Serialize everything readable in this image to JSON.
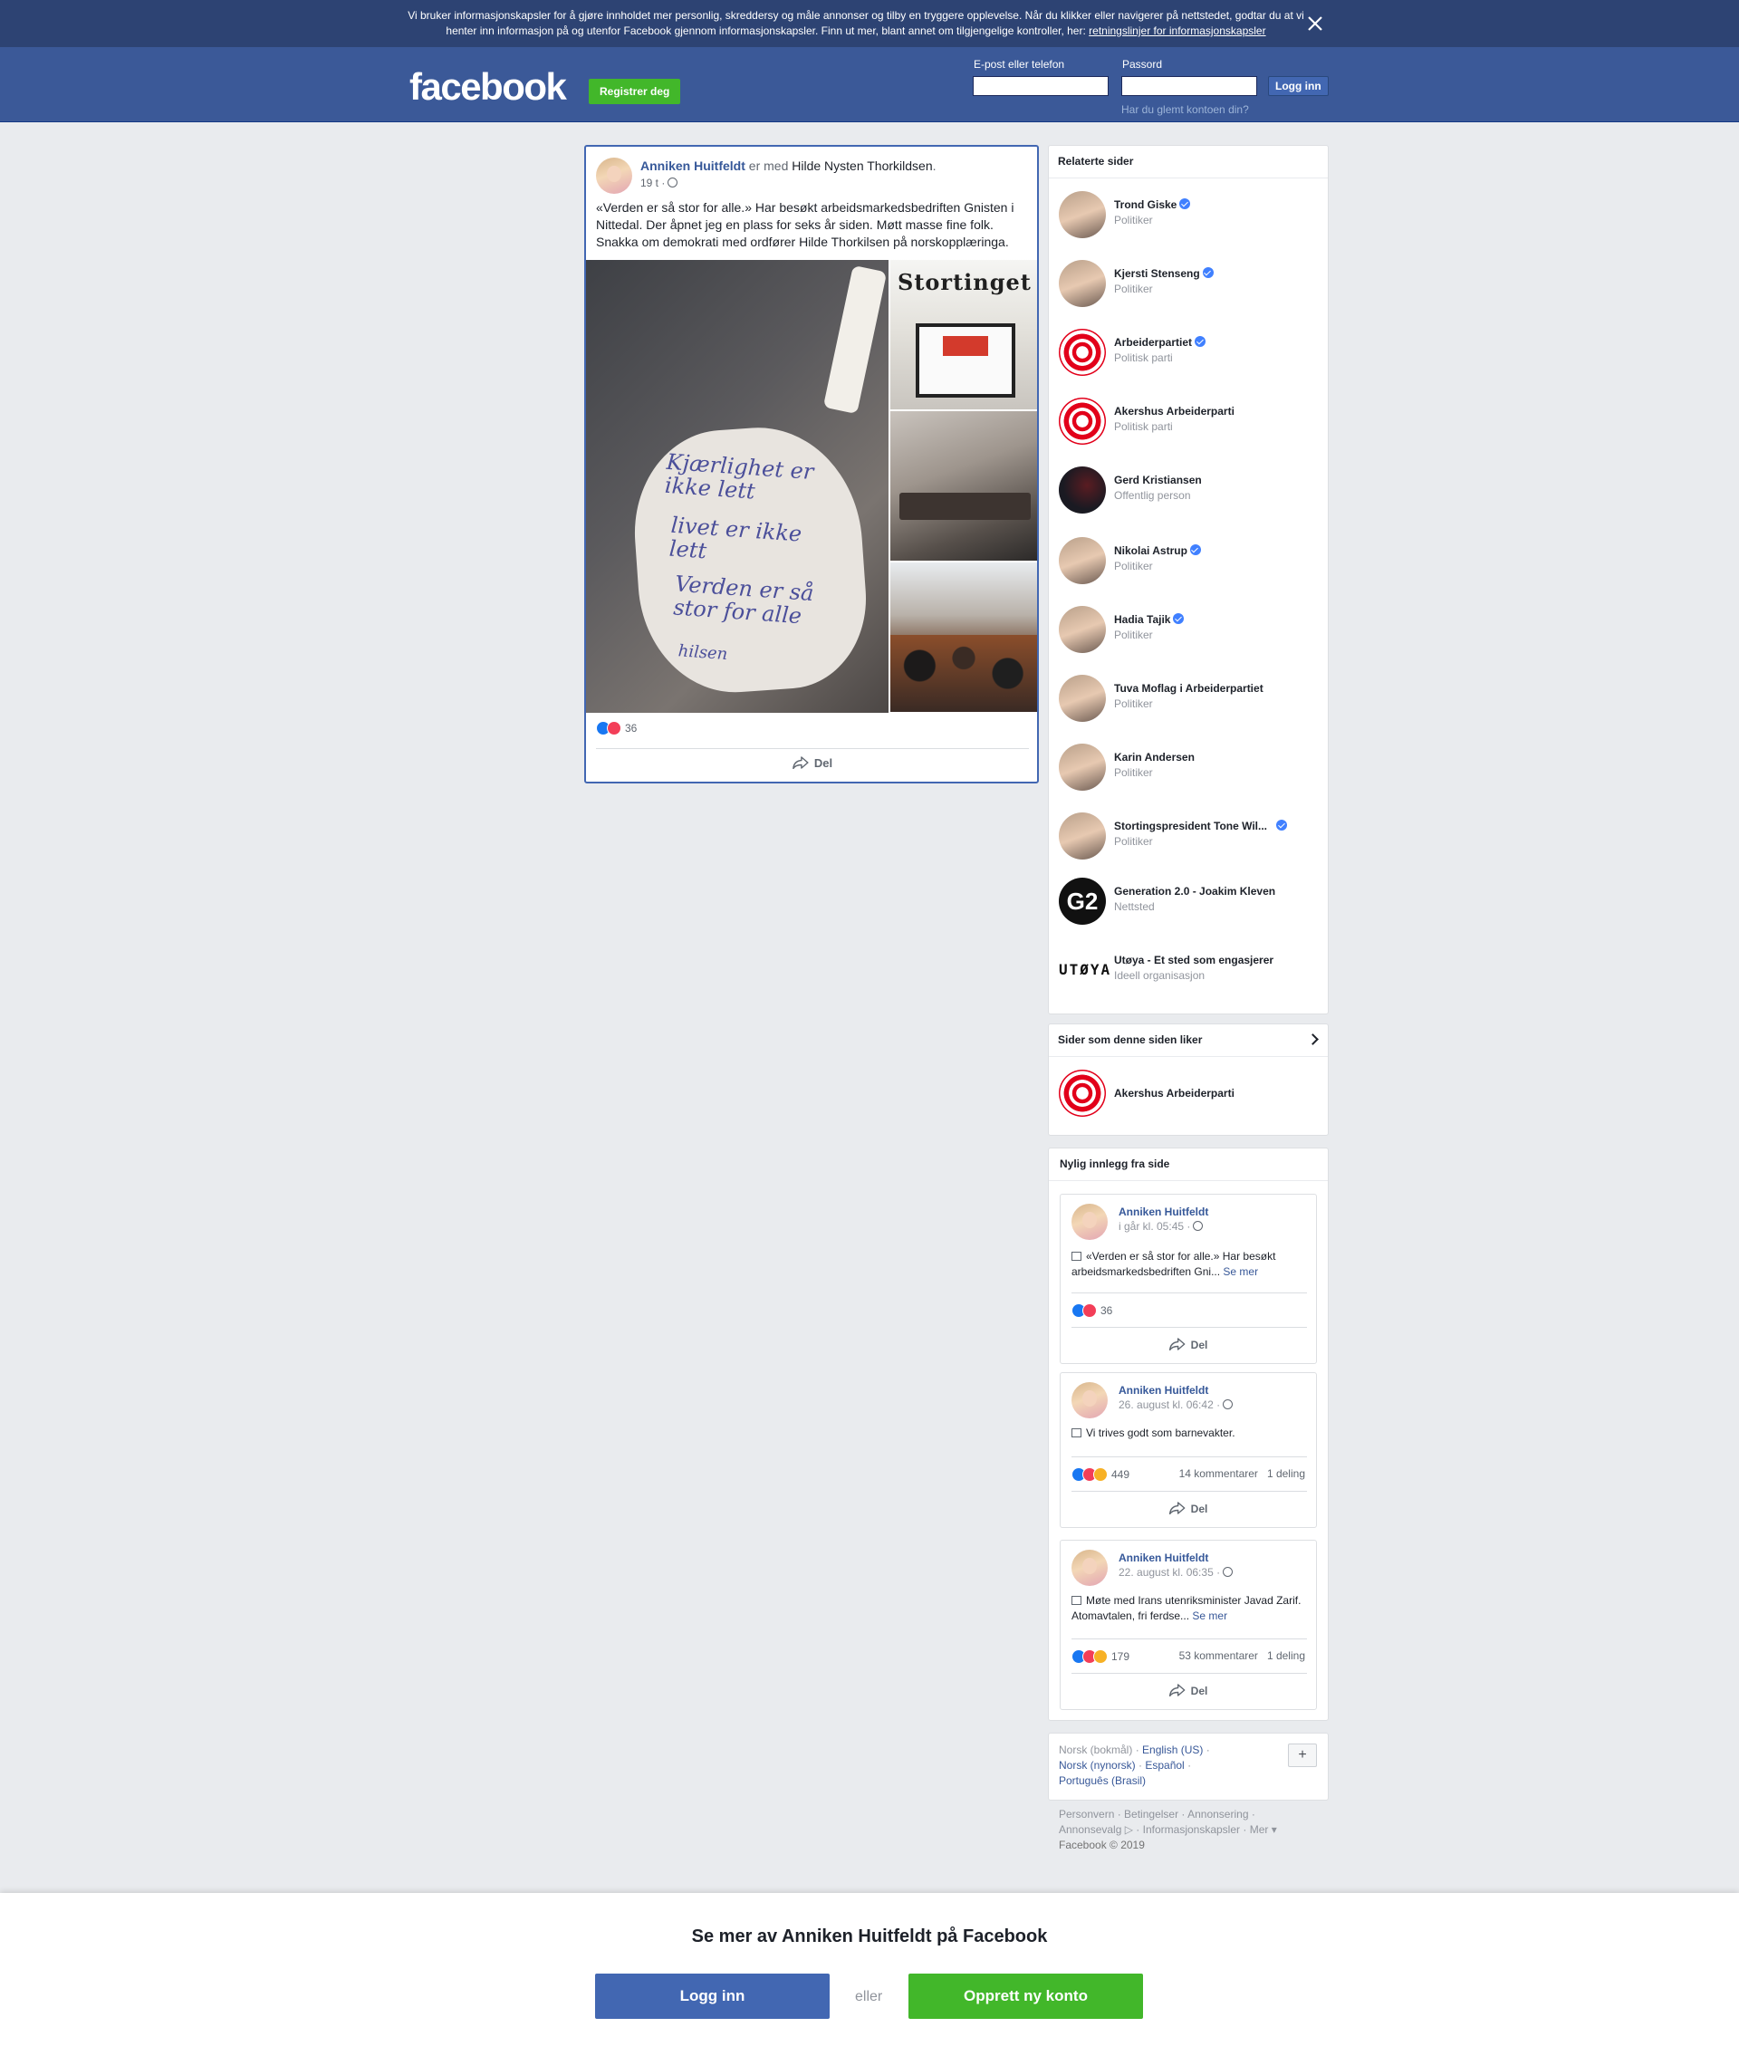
{
  "cookie_banner": {
    "text": "Vi bruker informasjonskapsler for å gjøre innholdet mer personlig, skreddersy og måle annonser og tilby en tryggere opplevelse. Når du klikker eller navigerer på nettstedet, godtar du at vi henter inn informasjon på og utenfor Facebook gjennom informasjonskapsler. Finn ut mer, blant annet om tilgjengelige kontroller, her: ",
    "link_text": "retningslinjer for informasjonskapsler"
  },
  "header": {
    "logo": "facebook",
    "register_label": "Registrer deg",
    "email_label": "E-post eller telefon",
    "email_value": "",
    "password_label": "Passord",
    "password_value": "",
    "login_label": "Logg inn",
    "forgot_label": "Har du glemt kontoen din?"
  },
  "post": {
    "author": "Anniken Huitfeldt",
    "with_text": " er med ",
    "with_person": "Hilde Nysten Thorkildsen",
    "with_suffix": ".",
    "time": "19 t ·",
    "text": "«Verden er så stor for alle.» Har besøkt arbeidsmarkedsbedriften Gnisten i Nittedal. Der åpnet jeg en plass for seks år siden. Møtt masse fine folk. Snakka om demokrati med ordfører Hilde Thorkilsen på norskopplæringa.",
    "note_lines": [
      "Kjærlighet er ikke lett",
      "livet er ikke lett",
      "Verden er så stor for alle",
      "hilsen"
    ],
    "photo_banner": "Stortinget",
    "reaction_count": "36",
    "share_label": "Del"
  },
  "related_pages": {
    "title": "Relaterte sider",
    "items": [
      {
        "name": "Trond Giske",
        "category": "Politiker",
        "verified": true
      },
      {
        "name": "Kjersti Stenseng",
        "category": "Politiker",
        "verified": true
      },
      {
        "name": "Arbeiderpartiet",
        "category": "Politisk parti",
        "verified": true
      },
      {
        "name": "Akershus Arbeiderparti",
        "category": "Politisk parti",
        "verified": false
      },
      {
        "name": "Gerd Kristiansen",
        "category": "Offentlig person",
        "verified": false
      },
      {
        "name": "Nikolai Astrup",
        "category": "Politiker",
        "verified": true
      },
      {
        "name": "Hadia Tajik",
        "category": "Politiker",
        "verified": true
      },
      {
        "name": "Tuva Moflag i Arbeiderpartiet",
        "category": "Politiker",
        "verified": false
      },
      {
        "name": "Karin Andersen",
        "category": "Politiker",
        "verified": false
      },
      {
        "name": "Stortingspresident Tone Wil...",
        "category": "Politiker",
        "verified": true
      },
      {
        "name": "Generation 2.0 - Joakim Kleven",
        "category": "Nettsted",
        "verified": false
      },
      {
        "name": "Utøya - Et sted som engasjerer",
        "category": "Ideell organisasjon",
        "verified": false
      }
    ],
    "g2_text": "G2",
    "utoya_text": "UTØYA"
  },
  "liked_pages": {
    "title": "Sider som denne siden liker",
    "items": [
      {
        "name": "Akershus Arbeiderparti"
      }
    ]
  },
  "recent_posts": {
    "title": "Nylig innlegg fra side",
    "items": [
      {
        "author": "Anniken Huitfeldt",
        "time": "i går kl. 05:45 ·",
        "text": "«Verden er så stor for alle.» Har besøkt arbeidsmarkedsbedriften Gni... ",
        "see_more": "Se mer",
        "reactions": "36",
        "comments": "",
        "shares": "",
        "share_label": "Del"
      },
      {
        "author": "Anniken Huitfeldt",
        "time": "26. august kl. 06:42 ·",
        "text": "Vi trives godt som barnevakter.",
        "see_more": "",
        "reactions": "449",
        "comments": "14 kommentarer",
        "shares": "1 deling",
        "share_label": "Del"
      },
      {
        "author": "Anniken Huitfeldt",
        "time": "22. august kl. 06:35 ·",
        "text": "Møte med Irans utenriksminister Javad Zarif. Atomavtalen, fri ferdse... ",
        "see_more": "Se mer",
        "reactions": "179",
        "comments": "53 kommentarer",
        "shares": "1 deling",
        "share_label": "Del"
      }
    ]
  },
  "languages": {
    "current": "Norsk (bokmål)",
    "sep": " · ",
    "items": [
      "English (US)",
      "Norsk (nynorsk)",
      "Español",
      "Português (Brasil)"
    ],
    "plus": "+"
  },
  "footer": {
    "links": [
      "Personvern",
      "Betingelser",
      "Annonsering",
      "Annonsevalg",
      "Informasjonskapsler",
      "Mer"
    ],
    "copyright": "Facebook © 2019"
  },
  "bottom_bar": {
    "title": "Se mer av Anniken Huitfeldt på Facebook",
    "login_label": "Logg inn",
    "or_label": "eller",
    "create_label": "Opprett ny konto"
  },
  "colors": {
    "brand": "#3b5998",
    "link": "#385898",
    "green": "#42b72a",
    "page_bg": "#e9ebee"
  }
}
